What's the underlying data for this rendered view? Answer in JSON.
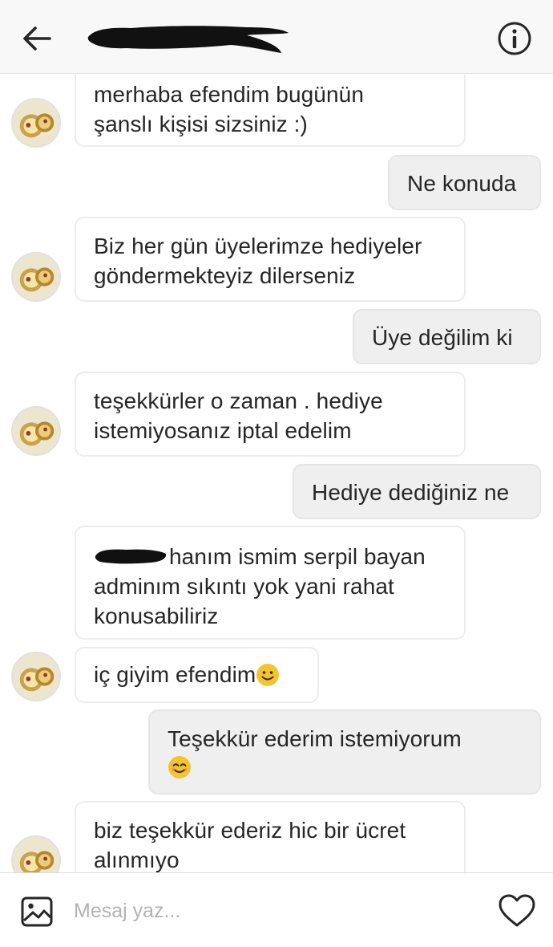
{
  "header": {
    "back_icon": "arrow-left-icon",
    "info_icon": "info-circle-icon"
  },
  "messages": [
    {
      "from": "them",
      "lines": [
        "merhaba efendim bugünün",
        "şanslı kişisi sizsiniz :)"
      ]
    },
    {
      "from": "me",
      "lines": [
        "Ne konuda"
      ]
    },
    {
      "from": "them",
      "lines": [
        "Biz her gün üyelerimze hediyeler",
        "göndermekteyiz dilerseniz"
      ]
    },
    {
      "from": "me",
      "lines": [
        "Üye değilim ki"
      ]
    },
    {
      "from": "them",
      "lines": [
        "teşekkürler o zaman . hediye",
        "istemiyosanız iptal edelim"
      ]
    },
    {
      "from": "me",
      "lines": [
        "Hediye dediğiniz ne"
      ]
    },
    {
      "from": "them",
      "lines": [
        "hanım ismim serpil bayan",
        "adminım sıkıntı yok yani rahat",
        "konusabiliriz"
      ]
    },
    {
      "from": "them",
      "lines": [
        "iç giyim efendim"
      ],
      "emoji": "smiling-face-emoji"
    },
    {
      "from": "me",
      "lines": [
        "Teşekkür ederim istemiyorum"
      ],
      "emoji": "smiling-eyes-face-emoji"
    },
    {
      "from": "them",
      "lines": [
        "biz teşekkür ederiz hic bir ücret",
        "alınmıyo"
      ]
    }
  ],
  "composer": {
    "placeholder": "Mesaj yaz...",
    "gallery_icon": "image-gallery-icon",
    "like_icon": "heart-icon"
  },
  "colors": {
    "incoming_bubble": "#ffffff",
    "outgoing_bubble": "#efefef",
    "border": "#ececec",
    "emoji_yellow": "#f4c430"
  }
}
